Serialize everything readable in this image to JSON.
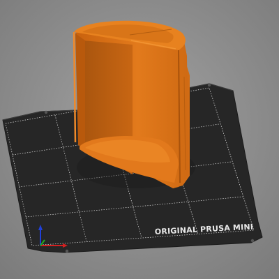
{
  "bed": {
    "label": "ORIGINAL PRUSA MINI"
  },
  "colors": {
    "background_top": "#9a9a9a",
    "background_bottom": "#7e7e7e",
    "bed_surface": "#2b2b2b",
    "bed_grid": "#d8d8d8",
    "model_orange": "#e37a1f",
    "model_dark": "#b35d10",
    "axis_x": "#d42020",
    "axis_y": "#20b020",
    "axis_z": "#2040d8"
  },
  "icons": {
    "axes_gizmo": "axes-gizmo-icon"
  }
}
